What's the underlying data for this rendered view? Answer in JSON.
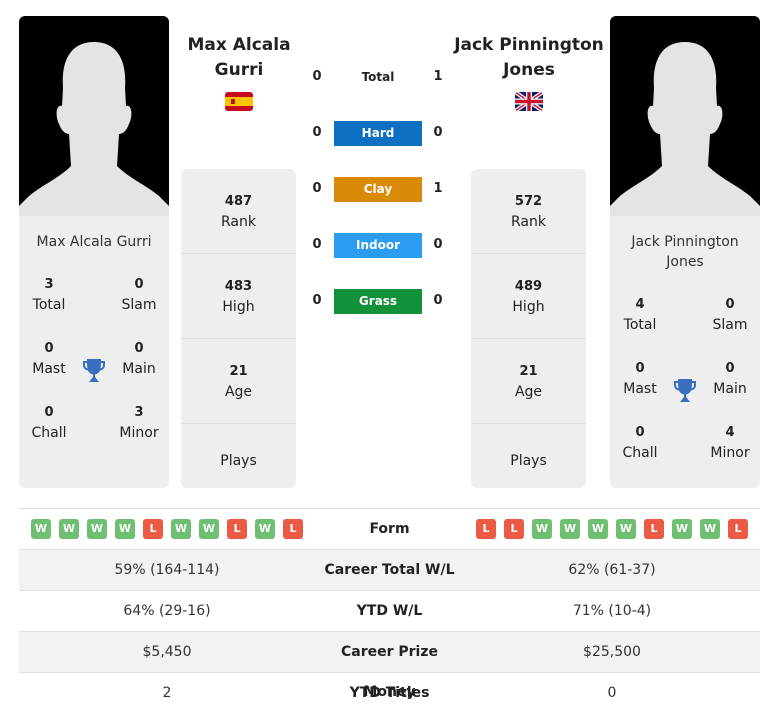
{
  "player_left": {
    "name_heading": "Max Alcala Gurri",
    "name_card": "Max Alcala Gurri",
    "flag": "spain-flag",
    "titles": {
      "total": {
        "value": "3",
        "label": "Total"
      },
      "slam": {
        "value": "0",
        "label": "Slam"
      },
      "mast": {
        "value": "0",
        "label": "Mast"
      },
      "main": {
        "value": "0",
        "label": "Main"
      },
      "chall": {
        "value": "0",
        "label": "Chall"
      },
      "minor": {
        "value": "3",
        "label": "Minor"
      }
    },
    "stats": {
      "rank": {
        "value": "487",
        "label": "Rank"
      },
      "high": {
        "value": "483",
        "label": "High"
      },
      "age": {
        "value": "21",
        "label": "Age"
      },
      "plays": {
        "value": "",
        "label": "Plays"
      }
    },
    "form": [
      "W",
      "W",
      "W",
      "W",
      "L",
      "W",
      "W",
      "L",
      "W",
      "L"
    ]
  },
  "player_right": {
    "name_heading": "Jack Pinnington Jones",
    "name_card": "Jack Pinnington Jones",
    "flag": "uk-flag",
    "titles": {
      "total": {
        "value": "4",
        "label": "Total"
      },
      "slam": {
        "value": "0",
        "label": "Slam"
      },
      "mast": {
        "value": "0",
        "label": "Mast"
      },
      "main": {
        "value": "0",
        "label": "Main"
      },
      "chall": {
        "value": "0",
        "label": "Chall"
      },
      "minor": {
        "value": "4",
        "label": "Minor"
      }
    },
    "stats": {
      "rank": {
        "value": "572",
        "label": "Rank"
      },
      "high": {
        "value": "489",
        "label": "High"
      },
      "age": {
        "value": "21",
        "label": "Age"
      },
      "plays": {
        "value": "",
        "label": "Plays"
      }
    },
    "form": [
      "L",
      "L",
      "W",
      "W",
      "W",
      "W",
      "L",
      "W",
      "W",
      "L"
    ]
  },
  "head_to_head": [
    {
      "label": "Total",
      "left": "0",
      "right": "1",
      "color": ""
    },
    {
      "label": "Hard",
      "left": "0",
      "right": "0",
      "color": "#0f6fc0"
    },
    {
      "label": "Clay",
      "left": "0",
      "right": "1",
      "color": "#d98a07"
    },
    {
      "label": "Indoor",
      "left": "0",
      "right": "0",
      "color": "#2b9cf0"
    },
    {
      "label": "Grass",
      "left": "0",
      "right": "0",
      "color": "#12913b"
    }
  ],
  "comparison": {
    "form_label": "Form",
    "rows": [
      {
        "label": "Career Total W/L",
        "left": "59% (164-114)",
        "right": "62% (61-37)"
      },
      {
        "label": "YTD W/L",
        "left": "64% (29-16)",
        "right": "71% (10-4)"
      },
      {
        "label": "Career Prize Money",
        "left": "$5,450",
        "right": "$25,500"
      },
      {
        "label": "YTD Titles",
        "left": "2",
        "right": "0"
      }
    ]
  },
  "colors": {
    "win": "#6fbf73",
    "loss": "#ea5a44",
    "trophy": "#3a6fc0"
  }
}
